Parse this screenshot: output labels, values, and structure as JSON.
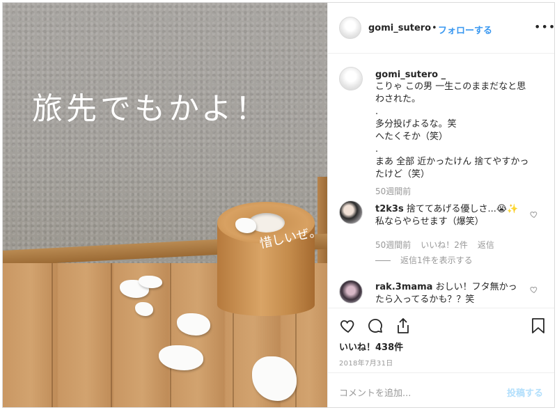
{
  "photo": {
    "overlay_text": "旅先でもかよ！",
    "bin_text": "惜しいぜ。"
  },
  "header": {
    "username": "gomi_sutero",
    "separator": "•",
    "follow_label": "フォローする",
    "more_label": "•••"
  },
  "caption": {
    "username": "gomi_sutero _",
    "lines": [
      "こりゃ この男 一生このままだなと思",
      "わされた。",
      ".",
      "多分投げよるな。笑",
      "へたくそか（笑）",
      ".",
      "まあ 全部 近かったけん 捨てやすかっ",
      "たけど（笑）"
    ],
    "time": "50週間前"
  },
  "comments": [
    {
      "username": "t2k3s",
      "lines": [
        "捨ててあげる優しさ...😭✨",
        "私ならやらせます（爆笑）"
      ],
      "time": "50週間前",
      "likes": "いいね！2件",
      "reply": "返信",
      "view_replies": "返信1件を表示する"
    },
    {
      "username": "rak.3mama",
      "lines": [
        "おしい！フタ無かっ",
        "たら入ってるかも？？笑"
      ]
    }
  ],
  "actions": {
    "likes": "いいね！438件",
    "date": "2018年7月31日"
  },
  "comment_box": {
    "placeholder": "コメントを追加...",
    "post_label": "投稿する"
  },
  "colors": {
    "link_blue": "#3897f0",
    "post_disabled": "#b2dffc",
    "muted": "#999999"
  }
}
